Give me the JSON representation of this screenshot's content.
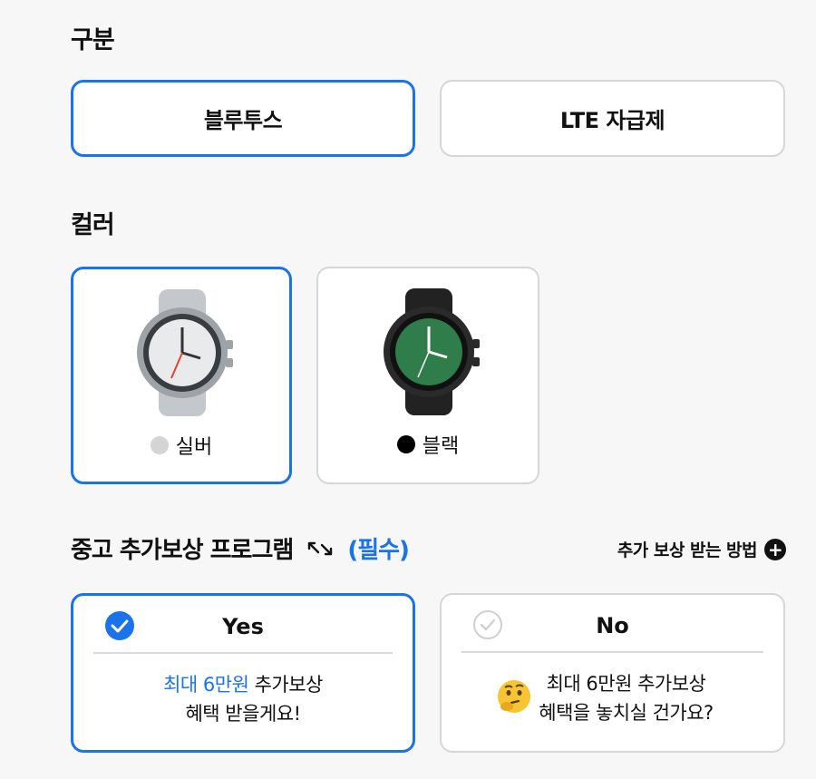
{
  "type_section": {
    "title": "구분",
    "options": [
      {
        "label": "블루투스",
        "selected": true
      },
      {
        "label": "LTE 자급제",
        "selected": false
      }
    ]
  },
  "color_section": {
    "title": "컬러",
    "options": [
      {
        "label": "실버",
        "swatch": "#d4d4d4",
        "selected": true
      },
      {
        "label": "블랙",
        "swatch": "#000000",
        "selected": false
      }
    ]
  },
  "trade_in": {
    "title": "중고 추가보상 프로그램",
    "required": "(필수)",
    "how_link": "추가 보상 받는 방법",
    "options": [
      {
        "title": "Yes",
        "highlight": "최대 6만원",
        "line1": " 추가보상",
        "line2": "혜택 받을게요!",
        "selected": true
      },
      {
        "title": "No",
        "line1": "최대 6만원 추가보상",
        "line2": "혜택을 놓치실 건가요?",
        "selected": false
      }
    ]
  },
  "colors": {
    "accent": "#1a73e8",
    "border": "#d6d6d6",
    "background": "#f7f7f7"
  }
}
